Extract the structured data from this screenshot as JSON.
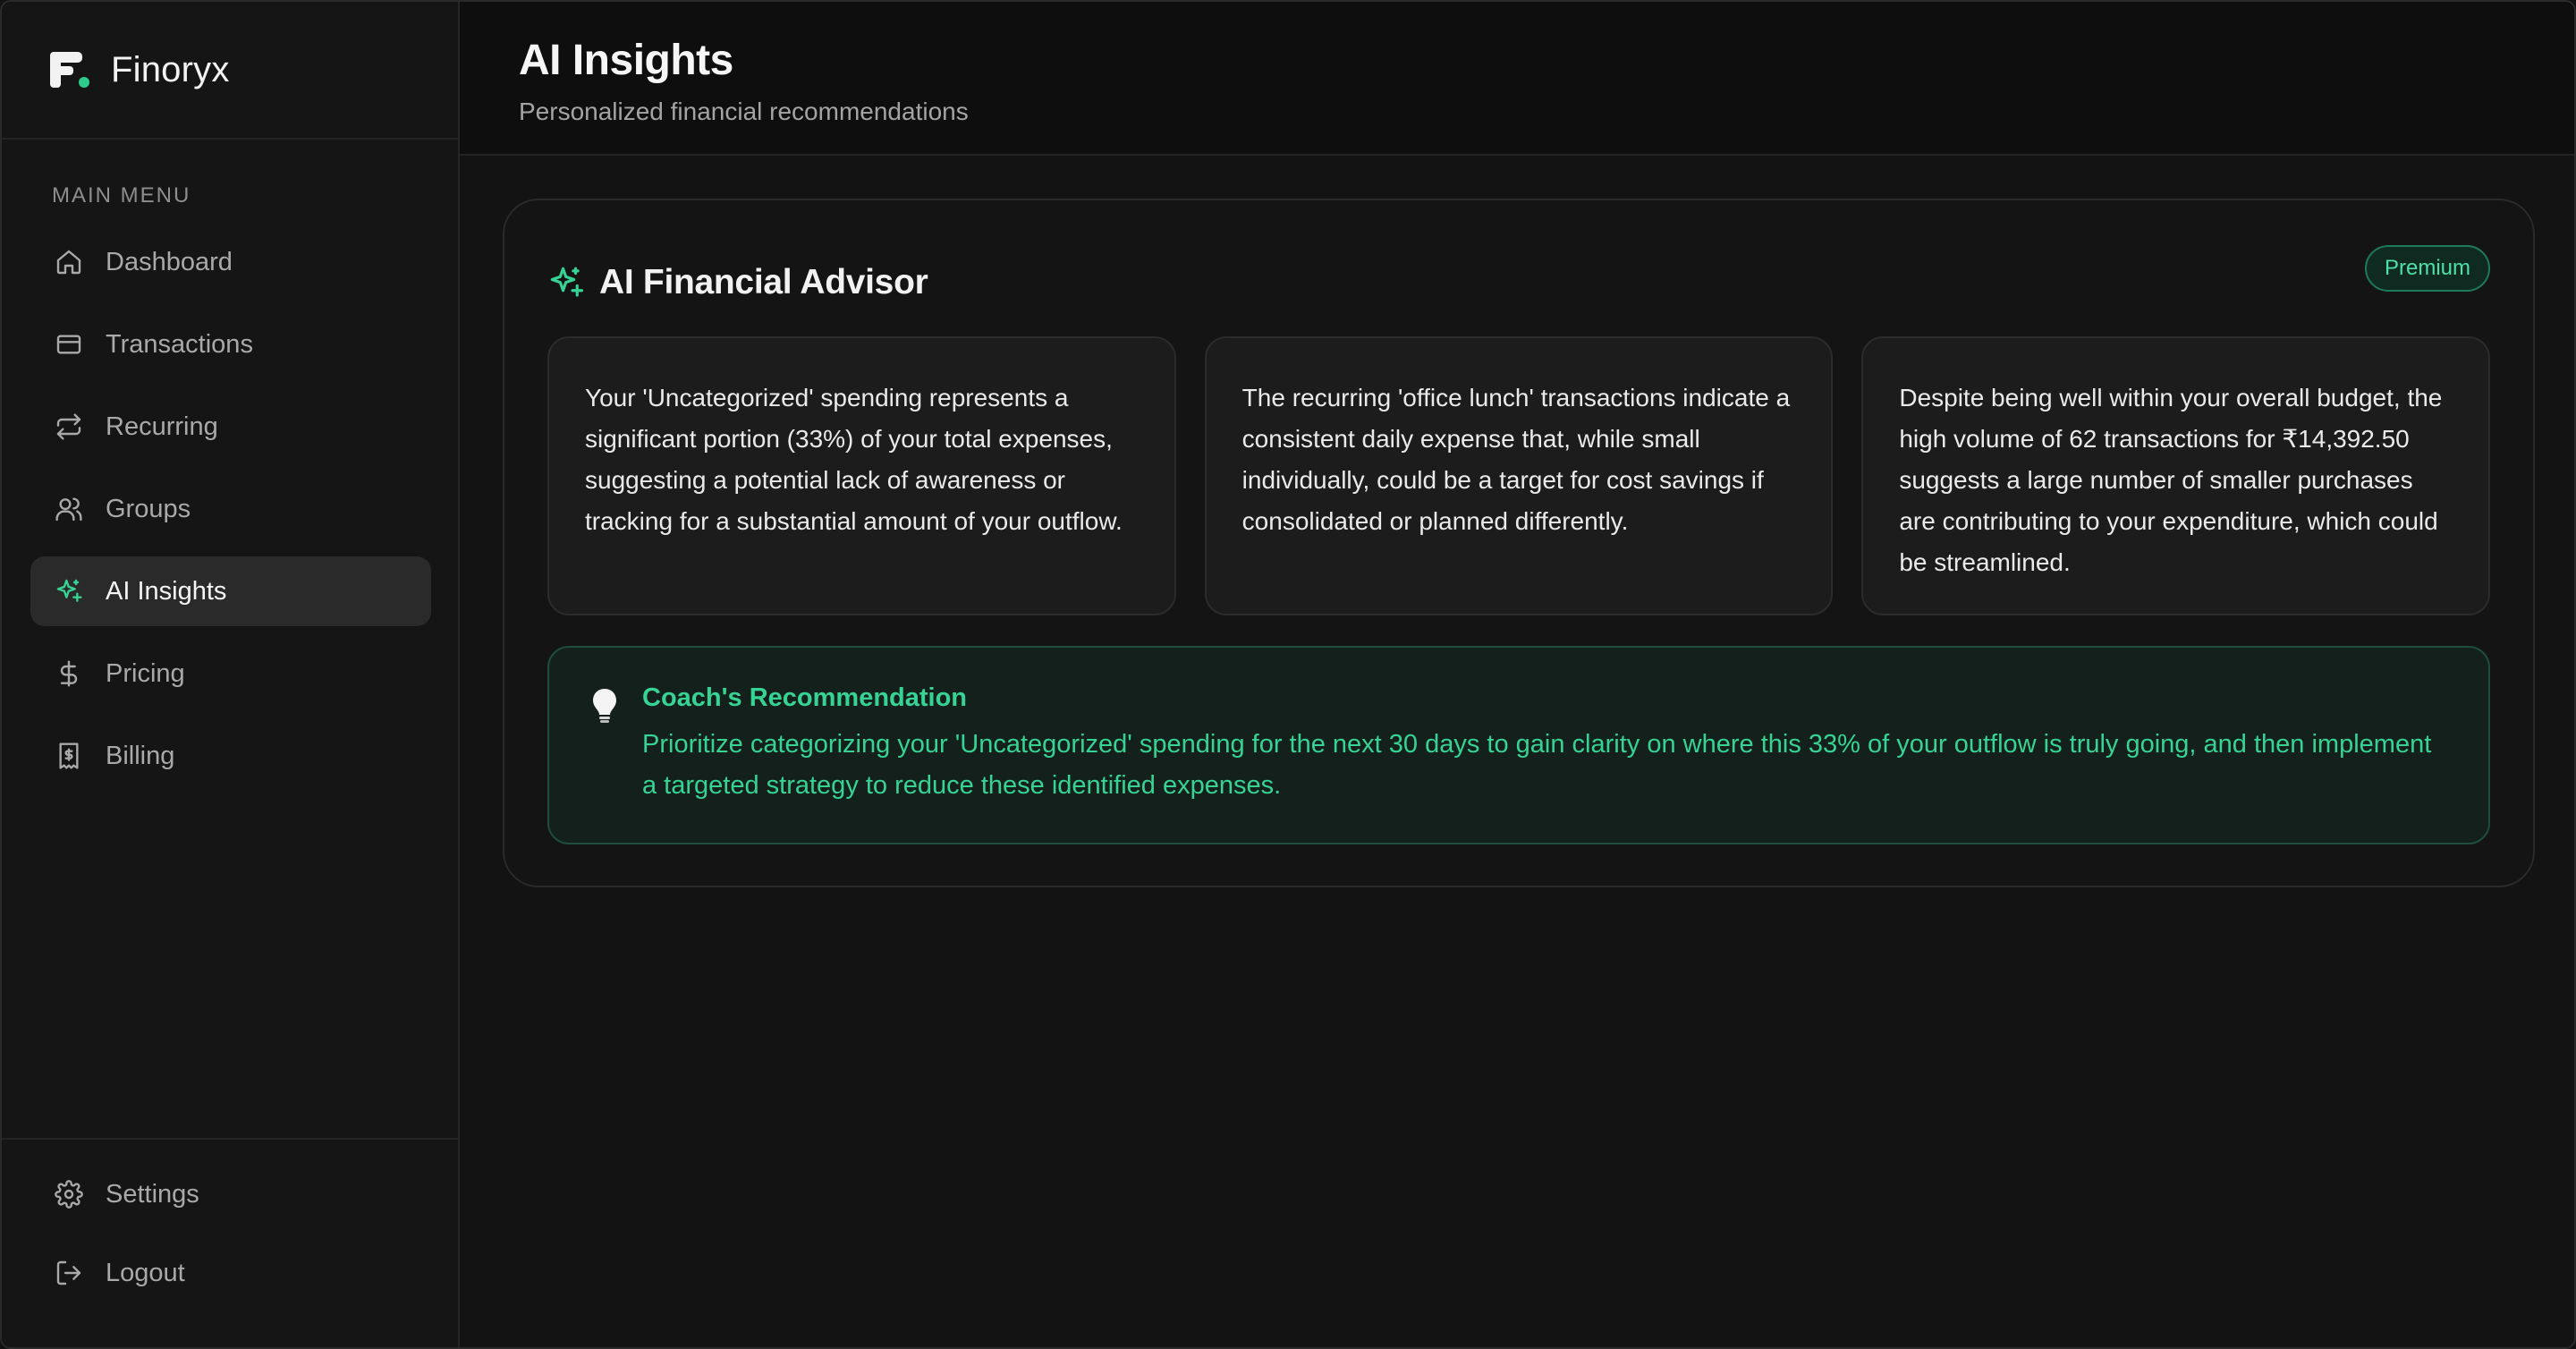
{
  "brand": {
    "name": "Finoryx"
  },
  "sidebar": {
    "menu_heading": "MAIN MENU",
    "items": [
      {
        "label": "Dashboard",
        "icon": "home-icon"
      },
      {
        "label": "Transactions",
        "icon": "credit-card-icon"
      },
      {
        "label": "Recurring",
        "icon": "repeat-icon"
      },
      {
        "label": "Groups",
        "icon": "users-icon"
      },
      {
        "label": "AI Insights",
        "icon": "sparkle-icon",
        "active": true
      },
      {
        "label": "Pricing",
        "icon": "dollar-icon"
      },
      {
        "label": "Billing",
        "icon": "receipt-icon"
      }
    ],
    "bottom": [
      {
        "label": "Settings",
        "icon": "gear-icon"
      },
      {
        "label": "Logout",
        "icon": "logout-icon"
      }
    ]
  },
  "header": {
    "title": "AI Insights",
    "subtitle": "Personalized financial recommendations"
  },
  "advisor": {
    "title": "AI Financial Advisor",
    "badge": "Premium",
    "insights": [
      "Your 'Uncategorized' spending represents a significant portion (33%) of your total expenses, suggesting a potential lack of awareness or tracking for a substantial amount of your outflow.",
      "The recurring 'office lunch' transactions indicate a consistent daily expense that, while small individually, could be a target for cost savings if consolidated or planned differently.",
      "Despite being well within your overall budget, the high volume of 62 transactions for ₹14,392.50 suggests a large number of smaller purchases are contributing to your expenditure, which could be streamlined."
    ],
    "coach": {
      "title": "Coach's Recommendation",
      "text": "Prioritize categorizing your 'Uncategorized' spending for the next 30 days to gain clarity on where this 33% of your outflow is truly going, and then implement a targeted strategy to reduce these identified expenses."
    }
  },
  "colors": {
    "accent": "#37d394",
    "background": "#131313",
    "sidebar": "#151515",
    "active_item": "#2a2a2a"
  }
}
